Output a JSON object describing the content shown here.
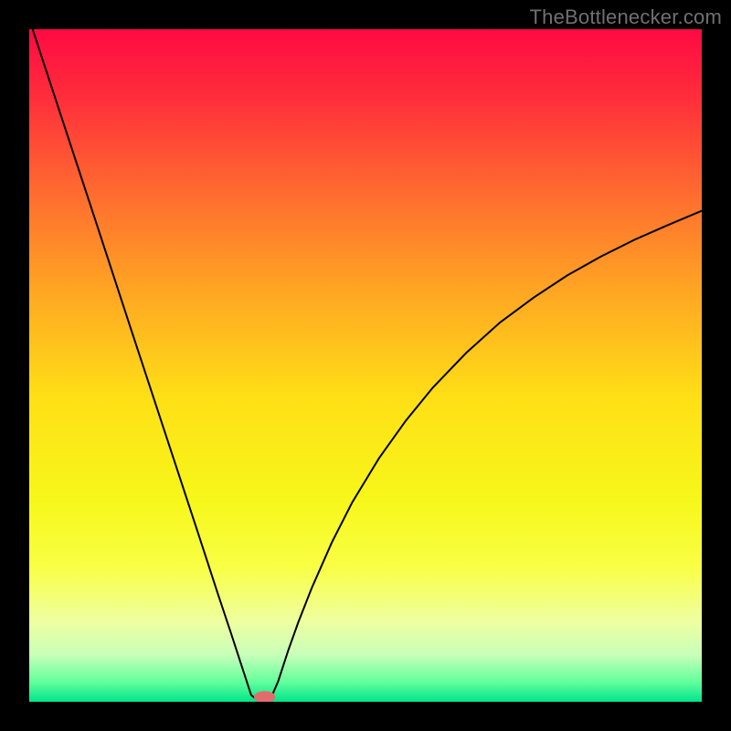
{
  "watermark": "TheBottlenecker.com",
  "chart_data": {
    "type": "line",
    "title": "",
    "xlabel": "",
    "ylabel": "",
    "xlim": [
      0,
      100
    ],
    "ylim": [
      0,
      100
    ],
    "grid": false,
    "legend": false,
    "background": {
      "type": "vertical-gradient",
      "stops": [
        {
          "offset": 0.0,
          "color": "#ff0a42"
        },
        {
          "offset": 0.1,
          "color": "#ff2d3b"
        },
        {
          "offset": 0.25,
          "color": "#ff6e2f"
        },
        {
          "offset": 0.4,
          "color": "#ffaa22"
        },
        {
          "offset": 0.55,
          "color": "#ffe016"
        },
        {
          "offset": 0.7,
          "color": "#f7f71a"
        },
        {
          "offset": 0.8,
          "color": "#f9ff45"
        },
        {
          "offset": 0.88,
          "color": "#efffa0"
        },
        {
          "offset": 0.93,
          "color": "#c8ffb9"
        },
        {
          "offset": 0.97,
          "color": "#64ff9d"
        },
        {
          "offset": 1.0,
          "color": "#00e58a"
        }
      ]
    },
    "series": [
      {
        "name": "curve",
        "color": "#000000",
        "width": 2,
        "x": [
          0.5,
          5,
          10,
          15,
          20,
          25,
          28,
          30,
          31.5,
          33,
          34,
          34.8,
          35.3,
          36,
          37,
          38.5,
          40,
          42,
          45,
          48,
          52,
          56,
          60,
          65,
          70,
          75,
          80,
          85,
          90,
          95,
          100
        ],
        "y": [
          100,
          86.3,
          71.1,
          55.8,
          40.6,
          25.4,
          16.2,
          10.2,
          5.6,
          1.0,
          0.2,
          0.0,
          0.0,
          0.7,
          3.0,
          7.6,
          11.8,
          16.9,
          23.7,
          29.6,
          36.2,
          41.8,
          46.7,
          51.9,
          56.4,
          60.1,
          63.4,
          66.2,
          68.7,
          70.9,
          73.0
        ]
      }
    ],
    "marker": {
      "x": 35.0,
      "y": 0.0,
      "rx": 1.6,
      "ry": 0.9,
      "color": "#e06d6d"
    }
  }
}
